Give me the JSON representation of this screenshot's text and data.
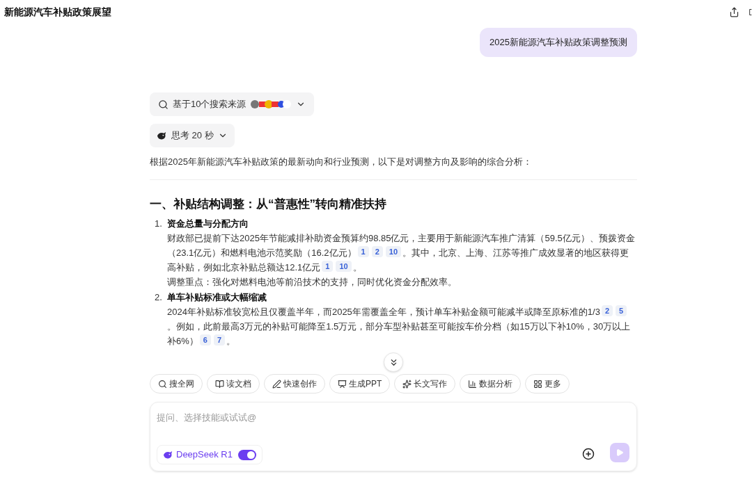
{
  "header": {
    "title": "新能源汽车补贴政策展望"
  },
  "user_message": "2025新能源汽车补贴政策调整预测",
  "sources": {
    "label": "基于10个搜索来源",
    "expanded": false
  },
  "thinking": {
    "label": "思考 20 秒",
    "expanded": false
  },
  "intro": "根据2025年新能源汽车补贴政策的最新动向和行业预测，以下是对调整方向及影响的综合分析：",
  "section_heading": "一、补贴结构调整：从“普惠性”转向精准扶持",
  "list": [
    {
      "number": "1.",
      "title": "资金总量与分配方向",
      "paragraphs": [
        [
          {
            "kind": "text",
            "text": "财政部已提前下达2025年节能减排补助资金预算约98.85亿元，主要用于新能源汽车推广清算（59.5亿元）、预拨资金（23.1亿元）和燃料电池示范奖励（16.2亿元）"
          },
          {
            "kind": "cite",
            "text": "1"
          },
          {
            "kind": "cite",
            "text": "2"
          },
          {
            "kind": "cite",
            "text": "10"
          },
          {
            "kind": "text",
            "text": "。其中，北京、上海、江苏等推广成效显著的地区获得更高补贴，例如北京补贴总额达12.1亿元"
          },
          {
            "kind": "cite",
            "text": "1"
          },
          {
            "kind": "cite",
            "text": "10"
          },
          {
            "kind": "text",
            "text": "。"
          }
        ],
        [
          {
            "kind": "text",
            "text": "调整重点：强化对燃料电池等前沿技术的支持，同时优化资金分配效率。"
          }
        ]
      ]
    },
    {
      "number": "2.",
      "title": "单车补贴标准或大幅缩减",
      "paragraphs": [
        [
          {
            "kind": "text",
            "text": "2024年补贴标准较宽松且仅覆盖半年，而2025年需覆盖全年，预计单车补贴金额可能减半或降至原标准的1/3"
          },
          {
            "kind": "cite",
            "text": "2"
          },
          {
            "kind": "cite",
            "text": "5"
          },
          {
            "kind": "text",
            "text": "。例如，此前最高3万元的补贴可能降至1.5万元，部分车型补贴甚至可能按车价分档（如15万以下补10%，30万以上补6%）"
          },
          {
            "kind": "cite",
            "text": "6"
          },
          {
            "kind": "cite",
            "text": "7"
          },
          {
            "kind": "text",
            "text": "。"
          }
        ]
      ]
    }
  ],
  "skills": [
    {
      "kind": "search",
      "label": "搜全网"
    },
    {
      "kind": "read",
      "label": "读文档"
    },
    {
      "kind": "pen",
      "label": "快速创作"
    },
    {
      "kind": "ppt",
      "label": "生成PPT"
    },
    {
      "kind": "sparkle",
      "label": "长文写作"
    },
    {
      "kind": "chart",
      "label": "数据分析"
    },
    {
      "kind": "grid",
      "label": "更多"
    }
  ],
  "composer": {
    "placeholder": "提问、选择技能或试试@",
    "model": "DeepSeek R1",
    "model_on": true,
    "send_disabled": true
  }
}
